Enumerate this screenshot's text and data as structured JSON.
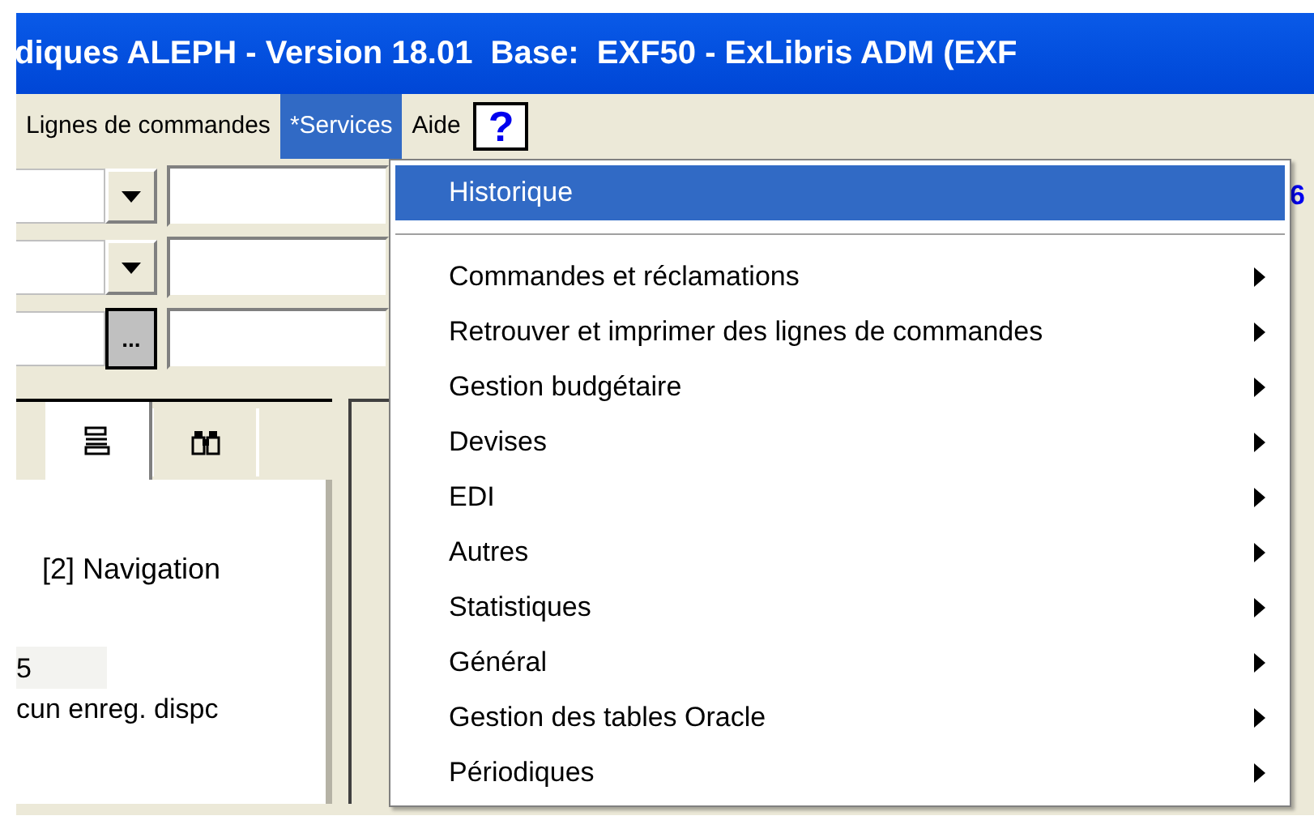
{
  "window": {
    "title": "diques ALEPH - Version 18.01  Base:  EXF50 - ExLibris ADM (EXF"
  },
  "menu_bar": {
    "items": [
      {
        "label": "Lignes de commandes",
        "selected": false
      },
      {
        "label": "*Services",
        "selected": true
      },
      {
        "label": "Aide",
        "selected": false
      }
    ],
    "help_button": "?"
  },
  "form": {
    "rows": [
      {
        "kind": "dropdown"
      },
      {
        "kind": "dropdown"
      },
      {
        "kind": "browse",
        "button": "..."
      }
    ]
  },
  "tabs": [
    {
      "kind": "list",
      "selected": true
    },
    {
      "kind": "binoculars",
      "selected": false
    }
  ],
  "panel": {
    "heading": "[2] Navigation",
    "column_1": "5",
    "message": "cun enreg. dispc"
  },
  "right_edge": {
    "value": "6"
  },
  "dropdown": [
    {
      "kind": "item",
      "label": "Historique",
      "selected": true,
      "submenu": false
    },
    {
      "kind": "separator"
    },
    {
      "kind": "item",
      "label": "Commandes et réclamations",
      "selected": false,
      "submenu": true
    },
    {
      "kind": "item",
      "label": "Retrouver et imprimer des lignes de commandes",
      "selected": false,
      "submenu": true
    },
    {
      "kind": "item",
      "label": "Gestion budgétaire",
      "selected": false,
      "submenu": true
    },
    {
      "kind": "item",
      "label": "Devises",
      "selected": false,
      "submenu": true
    },
    {
      "kind": "item",
      "label": "EDI",
      "selected": false,
      "submenu": true
    },
    {
      "kind": "item",
      "label": "Autres",
      "selected": false,
      "submenu": true
    },
    {
      "kind": "item",
      "label": "Statistiques",
      "selected": false,
      "submenu": true
    },
    {
      "kind": "item",
      "label": "Général",
      "selected": false,
      "submenu": true
    },
    {
      "kind": "item",
      "label": "Gestion des tables Oracle",
      "selected": false,
      "submenu": true
    },
    {
      "kind": "item",
      "label": "Périodiques",
      "selected": false,
      "submenu": true
    }
  ]
}
